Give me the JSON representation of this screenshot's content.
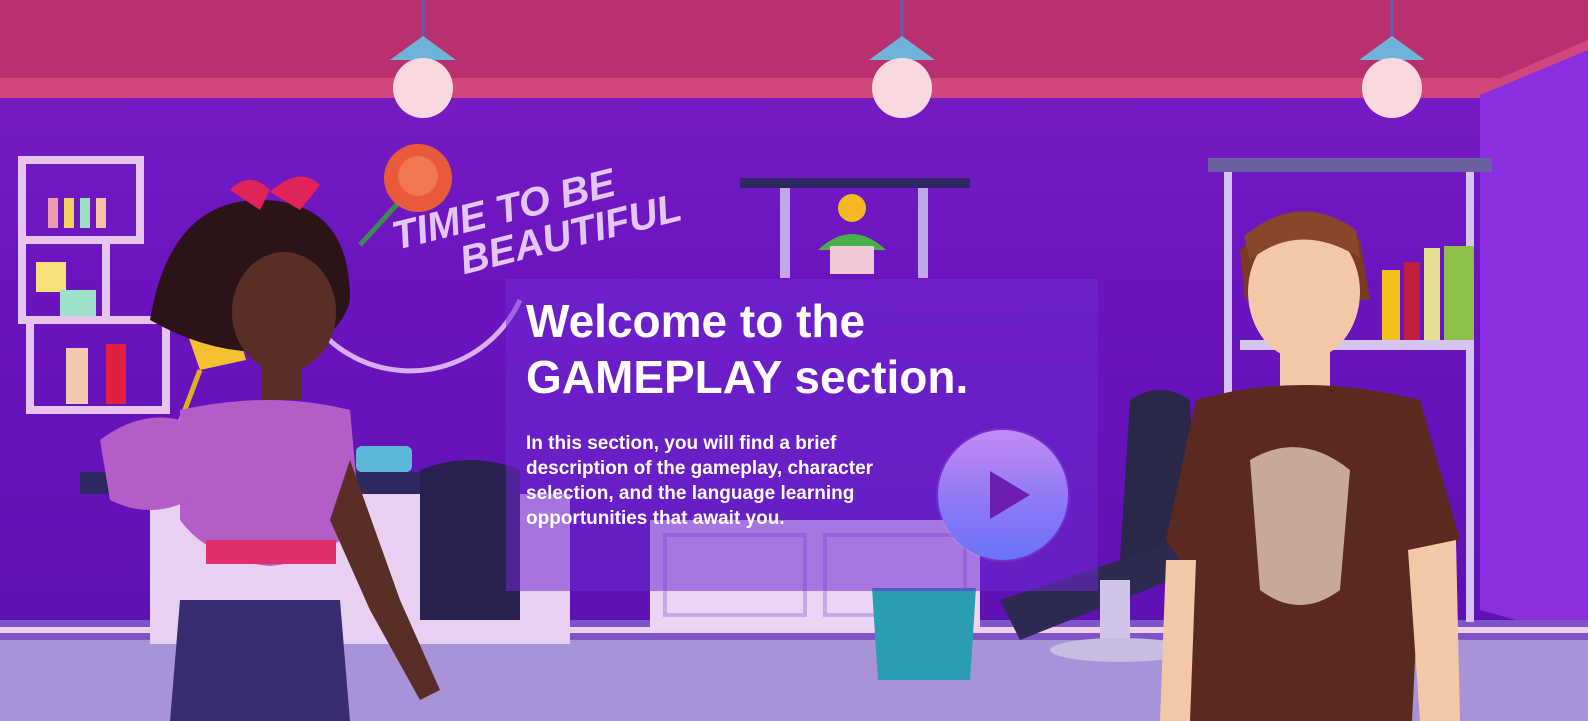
{
  "wall_sign": {
    "line1": "TIME TO BE",
    "line2": "BEAUTIFUL"
  },
  "panel": {
    "title_line1": "Welcome to the",
    "title_line2": "GAMEPLAY section.",
    "description_line1": "In this section, you will find a brief",
    "description_line2": "description of the gameplay, character",
    "description_line3": "selection, and the language learning",
    "description_line4": "opportunities that await you."
  },
  "play_button": {
    "icon": "play-icon"
  },
  "colors": {
    "ceiling": "#b8306e",
    "wall": "#6a14c0",
    "panel": "#6e28d2",
    "play_button": "#8e78f6",
    "play_icon": "#6a1fb0"
  }
}
